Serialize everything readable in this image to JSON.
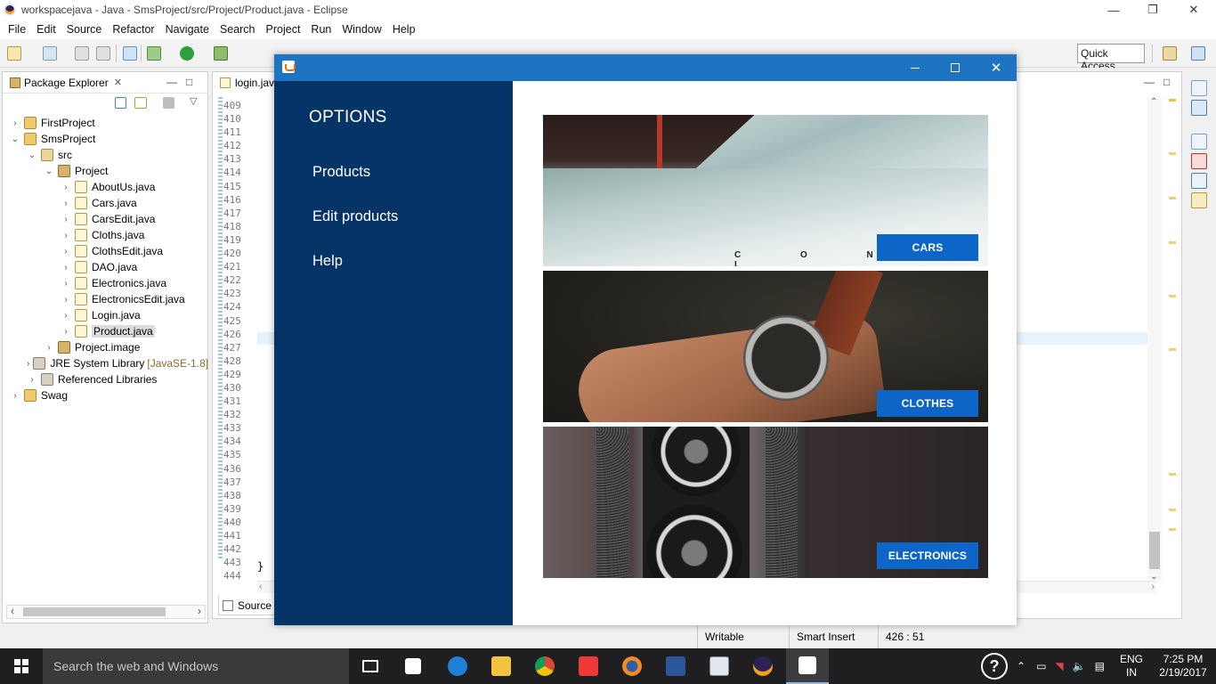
{
  "eclipse": {
    "title": "workspacejava - Java - SmsProject/src/Project/Product.java - Eclipse",
    "menu": [
      "File",
      "Edit",
      "Source",
      "Refactor",
      "Navigate",
      "Search",
      "Project",
      "Run",
      "Window",
      "Help"
    ],
    "quick_access": "Quick Access",
    "package_explorer": {
      "tab_label": "Package Explorer",
      "tree": [
        {
          "label": "FirstProject",
          "icon": "project-icon",
          "level": 0,
          "expanded": false
        },
        {
          "label": "SmsProject",
          "icon": "project-icon",
          "level": 0,
          "expanded": true
        },
        {
          "label": "src",
          "icon": "source-folder-icon",
          "level": 1,
          "expanded": true
        },
        {
          "label": "Project",
          "icon": "package-icon",
          "level": 2,
          "expanded": true
        },
        {
          "label": "AboutUs.java",
          "icon": "java-file-icon",
          "level": 3
        },
        {
          "label": "Cars.java",
          "icon": "java-file-icon",
          "level": 3
        },
        {
          "label": "CarsEdit.java",
          "icon": "java-file-icon",
          "level": 3
        },
        {
          "label": "Cloths.java",
          "icon": "java-file-icon",
          "level": 3
        },
        {
          "label": "ClothsEdit.java",
          "icon": "java-file-icon",
          "level": 3
        },
        {
          "label": "DAO.java",
          "icon": "java-file-icon",
          "level": 3
        },
        {
          "label": "Electronics.java",
          "icon": "java-file-icon",
          "level": 3
        },
        {
          "label": "ElectronicsEdit.java",
          "icon": "java-file-icon",
          "level": 3
        },
        {
          "label": "Login.java",
          "icon": "java-file-icon",
          "level": 3
        },
        {
          "label": "Product.java",
          "icon": "java-file-icon",
          "level": 3,
          "selected": true
        },
        {
          "label": "Project.image",
          "icon": "package-icon",
          "level": 2
        },
        {
          "label": "JRE System Library",
          "suffix": "[JavaSE-1.8]",
          "icon": "library-icon",
          "level": 1
        },
        {
          "label": "Referenced Libraries",
          "icon": "library-icon",
          "level": 1
        },
        {
          "label": "Swag",
          "icon": "project-icon",
          "level": 0
        }
      ]
    },
    "editor": {
      "tab_label": "login.jav",
      "line_numbers": [
        "409",
        "410",
        "411",
        "412",
        "413",
        "414",
        "415",
        "416",
        "417",
        "418",
        "419",
        "420",
        "421",
        "422",
        "423",
        "424",
        "425",
        "426",
        "427",
        "428",
        "429",
        "430",
        "431",
        "432",
        "433",
        "434",
        "435",
        "436",
        "437",
        "438",
        "439",
        "440",
        "441",
        "442",
        "443",
        "444"
      ],
      "code_line_443": "}",
      "bottom_tab": "Source"
    },
    "status": {
      "writable": "Writable",
      "insert_mode": "Smart Insert",
      "position": "426 : 51"
    }
  },
  "java_window": {
    "sidebar_title": "OPTIONS",
    "nav_items": [
      "Products",
      "Edit products",
      "Help"
    ],
    "categories": [
      {
        "label": "CARS",
        "image": "vintage car hood photo"
      },
      {
        "label": "CLOTHES",
        "image": "wristwatch on arm photo"
      },
      {
        "label": "ELECTRONICS",
        "image": "vintage twin-lens camera photo"
      }
    ],
    "car_emblem_text": "C O N T I",
    "accent_color": "#063466",
    "button_color": "#0d66c7",
    "titlebar_color": "#1e73c3"
  },
  "taskbar": {
    "search_placeholder": "Search the web and Windows",
    "apps": [
      "task-view-icon",
      "store-icon",
      "edge-icon",
      "file-explorer-icon",
      "chrome-icon",
      "vivaldi-icon",
      "firefox-icon",
      "word-icon",
      "photos-icon",
      "eclipse-icon",
      "java-icon"
    ],
    "language": "ENG",
    "region": "IN",
    "time": "7:25 PM",
    "date": "2/19/2017"
  }
}
